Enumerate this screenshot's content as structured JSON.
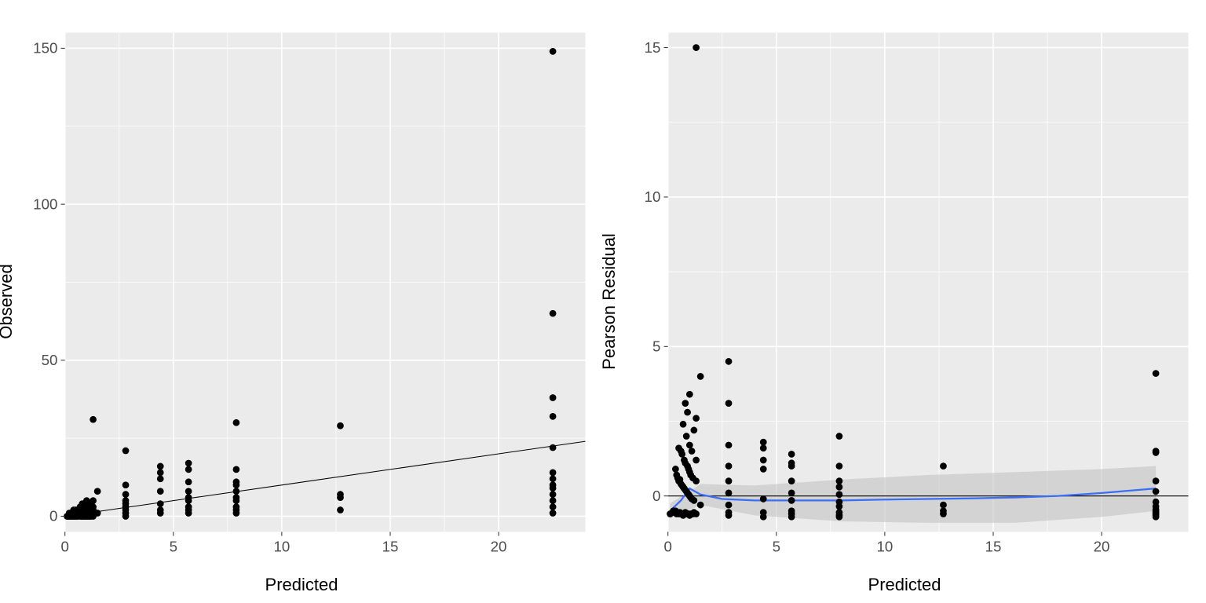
{
  "chart_data": [
    {
      "type": "scatter",
      "xlabel": "Predicted",
      "ylabel": "Observed",
      "xlim": [
        0,
        24
      ],
      "ylim": [
        -5,
        155
      ],
      "xticks": [
        0,
        5,
        10,
        15,
        20
      ],
      "yticks": [
        0,
        50,
        100,
        150
      ],
      "ref_line": {
        "slope": 1,
        "intercept": 0
      },
      "points": [
        [
          0.1,
          0
        ],
        [
          0.15,
          0
        ],
        [
          0.2,
          0
        ],
        [
          0.2,
          1
        ],
        [
          0.25,
          0
        ],
        [
          0.3,
          0
        ],
        [
          0.3,
          1
        ],
        [
          0.35,
          0
        ],
        [
          0.35,
          1
        ],
        [
          0.4,
          0
        ],
        [
          0.4,
          1
        ],
        [
          0.4,
          2
        ],
        [
          0.45,
          0
        ],
        [
          0.45,
          1
        ],
        [
          0.5,
          0
        ],
        [
          0.5,
          1
        ],
        [
          0.5,
          2
        ],
        [
          0.55,
          0
        ],
        [
          0.55,
          1
        ],
        [
          0.6,
          0
        ],
        [
          0.6,
          1
        ],
        [
          0.6,
          2
        ],
        [
          0.65,
          1
        ],
        [
          0.65,
          2
        ],
        [
          0.7,
          0
        ],
        [
          0.7,
          1
        ],
        [
          0.7,
          3
        ],
        [
          0.75,
          0
        ],
        [
          0.75,
          1
        ],
        [
          0.75,
          2
        ],
        [
          0.8,
          0
        ],
        [
          0.8,
          1
        ],
        [
          0.8,
          2
        ],
        [
          0.8,
          4
        ],
        [
          0.85,
          0
        ],
        [
          0.85,
          1
        ],
        [
          0.85,
          3
        ],
        [
          0.9,
          0
        ],
        [
          0.9,
          1
        ],
        [
          0.9,
          2
        ],
        [
          0.9,
          4
        ],
        [
          0.95,
          0
        ],
        [
          0.95,
          1
        ],
        [
          0.95,
          2
        ],
        [
          1,
          0
        ],
        [
          1,
          1
        ],
        [
          1,
          2
        ],
        [
          1,
          3
        ],
        [
          1,
          5
        ],
        [
          1.05,
          0
        ],
        [
          1.05,
          1
        ],
        [
          1.05,
          2
        ],
        [
          1.1,
          0
        ],
        [
          1.1,
          1
        ],
        [
          1.1,
          3
        ],
        [
          1.15,
          0
        ],
        [
          1.15,
          2
        ],
        [
          1.2,
          0
        ],
        [
          1.2,
          1
        ],
        [
          1.2,
          4
        ],
        [
          1.3,
          0
        ],
        [
          1.3,
          2
        ],
        [
          1.3,
          3
        ],
        [
          1.3,
          5
        ],
        [
          1.3,
          31
        ],
        [
          1.5,
          1
        ],
        [
          1.5,
          8
        ],
        [
          2.8,
          0
        ],
        [
          2.8,
          1
        ],
        [
          2.8,
          2
        ],
        [
          2.8,
          3
        ],
        [
          2.8,
          4
        ],
        [
          2.8,
          5
        ],
        [
          2.8,
          7
        ],
        [
          2.8,
          10
        ],
        [
          2.8,
          21
        ],
        [
          4.4,
          1
        ],
        [
          4.4,
          2
        ],
        [
          4.4,
          4
        ],
        [
          4.4,
          8
        ],
        [
          4.4,
          12
        ],
        [
          4.4,
          14
        ],
        [
          4.4,
          16
        ],
        [
          5.7,
          1
        ],
        [
          5.7,
          2
        ],
        [
          5.7,
          3
        ],
        [
          5.7,
          5
        ],
        [
          5.7,
          6
        ],
        [
          5.7,
          8
        ],
        [
          5.7,
          11
        ],
        [
          5.7,
          15
        ],
        [
          5.7,
          17
        ],
        [
          7.9,
          1
        ],
        [
          7.9,
          2
        ],
        [
          7.9,
          3
        ],
        [
          7.9,
          5
        ],
        [
          7.9,
          6
        ],
        [
          7.9,
          8
        ],
        [
          7.9,
          10
        ],
        [
          7.9,
          11
        ],
        [
          7.9,
          15
        ],
        [
          7.9,
          30
        ],
        [
          12.7,
          2
        ],
        [
          12.7,
          6
        ],
        [
          12.7,
          7
        ],
        [
          12.7,
          29
        ],
        [
          22.5,
          1
        ],
        [
          22.5,
          3
        ],
        [
          22.5,
          5
        ],
        [
          22.5,
          7
        ],
        [
          22.5,
          9
        ],
        [
          22.5,
          10
        ],
        [
          22.5,
          12
        ],
        [
          22.5,
          14
        ],
        [
          22.5,
          22
        ],
        [
          22.5,
          32
        ],
        [
          22.5,
          38
        ],
        [
          22.5,
          65
        ],
        [
          22.5,
          149
        ]
      ]
    },
    {
      "type": "scatter",
      "xlabel": "Predicted",
      "ylabel": "Pearson Residual",
      "xlim": [
        0,
        24
      ],
      "ylim": [
        -1.2,
        15.5
      ],
      "xticks": [
        0,
        5,
        10,
        15,
        20
      ],
      "yticks": [
        0,
        5,
        10,
        15
      ],
      "ref_line": {
        "y": 0
      },
      "loess": [
        [
          0.1,
          -0.5
        ],
        [
          0.6,
          -0.15
        ],
        [
          1.0,
          0.25
        ],
        [
          1.5,
          0.05
        ],
        [
          2.5,
          -0.1
        ],
        [
          4,
          -0.15
        ],
        [
          6,
          -0.15
        ],
        [
          8,
          -0.15
        ],
        [
          10,
          -0.12
        ],
        [
          12,
          -0.1
        ],
        [
          14,
          -0.08
        ],
        [
          16,
          -0.05
        ],
        [
          18,
          0
        ],
        [
          20,
          0.1
        ],
        [
          22.5,
          0.25
        ]
      ],
      "loess_band_half": [
        [
          0.1,
          0.25
        ],
        [
          1.5,
          0.35
        ],
        [
          4,
          0.5
        ],
        [
          8,
          0.7
        ],
        [
          12,
          0.8
        ],
        [
          16,
          0.85
        ],
        [
          20,
          0.8
        ],
        [
          22.5,
          0.75
        ]
      ],
      "points": [
        [
          0.1,
          -0.6
        ],
        [
          0.2,
          -0.55
        ],
        [
          0.25,
          -0.5
        ],
        [
          0.3,
          -0.55
        ],
        [
          0.35,
          -0.5
        ],
        [
          0.35,
          0.9
        ],
        [
          0.4,
          -0.6
        ],
        [
          0.4,
          0.7
        ],
        [
          0.45,
          -0.55
        ],
        [
          0.45,
          0.6
        ],
        [
          0.5,
          -0.6
        ],
        [
          0.5,
          0.5
        ],
        [
          0.5,
          1.6
        ],
        [
          0.55,
          -0.55
        ],
        [
          0.55,
          0.55
        ],
        [
          0.6,
          -0.6
        ],
        [
          0.6,
          0.4
        ],
        [
          0.6,
          1.5
        ],
        [
          0.65,
          0.35
        ],
        [
          0.65,
          1.4
        ],
        [
          0.7,
          -0.65
        ],
        [
          0.7,
          0.3
        ],
        [
          0.7,
          2.4
        ],
        [
          0.75,
          -0.6
        ],
        [
          0.75,
          0.25
        ],
        [
          0.75,
          1.2
        ],
        [
          0.8,
          -0.55
        ],
        [
          0.8,
          0.2
        ],
        [
          0.8,
          1.1
        ],
        [
          0.8,
          3.1
        ],
        [
          0.85,
          -0.6
        ],
        [
          0.85,
          0.15
        ],
        [
          0.85,
          2.0
        ],
        [
          0.9,
          -0.6
        ],
        [
          0.9,
          0.1
        ],
        [
          0.9,
          1.0
        ],
        [
          0.9,
          2.8
        ],
        [
          0.95,
          -0.6
        ],
        [
          0.95,
          0.05
        ],
        [
          0.95,
          0.9
        ],
        [
          1,
          -0.65
        ],
        [
          1,
          0
        ],
        [
          1,
          0.8
        ],
        [
          1,
          1.7
        ],
        [
          1,
          3.4
        ],
        [
          1.05,
          -0.6
        ],
        [
          1.05,
          -0.05
        ],
        [
          1.05,
          0.7
        ],
        [
          1.1,
          -0.6
        ],
        [
          1.1,
          -0.1
        ],
        [
          1.1,
          1.5
        ],
        [
          1.15,
          -0.6
        ],
        [
          1.15,
          0.6
        ],
        [
          1.2,
          -0.55
        ],
        [
          1.2,
          -0.15
        ],
        [
          1.2,
          2.2
        ],
        [
          1.3,
          -0.6
        ],
        [
          1.3,
          0.5
        ],
        [
          1.3,
          1.2
        ],
        [
          1.3,
          2.6
        ],
        [
          1.3,
          15
        ],
        [
          1.5,
          -0.3
        ],
        [
          1.5,
          4.0
        ],
        [
          2.8,
          -0.65
        ],
        [
          2.8,
          -0.55
        ],
        [
          2.8,
          -0.3
        ],
        [
          2.8,
          0.1
        ],
        [
          2.8,
          0.5
        ],
        [
          2.8,
          1.0
        ],
        [
          2.8,
          1.7
        ],
        [
          2.8,
          3.1
        ],
        [
          2.8,
          4.5
        ],
        [
          4.4,
          -0.7
        ],
        [
          4.4,
          -0.55
        ],
        [
          4.4,
          -0.1
        ],
        [
          4.4,
          0.9
        ],
        [
          4.4,
          1.6
        ],
        [
          4.4,
          1.8
        ],
        [
          4.4,
          1.2
        ],
        [
          5.7,
          -0.7
        ],
        [
          5.7,
          -0.6
        ],
        [
          5.7,
          -0.5
        ],
        [
          5.7,
          -0.15
        ],
        [
          5.7,
          0.1
        ],
        [
          5.7,
          0.5
        ],
        [
          5.7,
          1.0
        ],
        [
          5.7,
          1.4
        ],
        [
          5.7,
          1.1
        ],
        [
          7.9,
          -0.7
        ],
        [
          7.9,
          -0.65
        ],
        [
          7.9,
          -0.55
        ],
        [
          7.9,
          -0.35
        ],
        [
          7.9,
          -0.2
        ],
        [
          7.9,
          0.05
        ],
        [
          7.9,
          0.3
        ],
        [
          7.9,
          0.5
        ],
        [
          7.9,
          1.0
        ],
        [
          7.9,
          2.0
        ],
        [
          12.7,
          -0.6
        ],
        [
          12.7,
          -0.5
        ],
        [
          12.7,
          -0.3
        ],
        [
          12.7,
          1.0
        ],
        [
          22.5,
          -0.7
        ],
        [
          22.5,
          -0.65
        ],
        [
          22.5,
          -0.6
        ],
        [
          22.5,
          -0.55
        ],
        [
          22.5,
          -0.5
        ],
        [
          22.5,
          -0.45
        ],
        [
          22.5,
          -0.35
        ],
        [
          22.5,
          -0.2
        ],
        [
          22.5,
          0.15
        ],
        [
          22.5,
          0.5
        ],
        [
          22.5,
          1.45
        ],
        [
          22.5,
          1.5
        ],
        [
          22.5,
          4.1
        ]
      ]
    }
  ]
}
